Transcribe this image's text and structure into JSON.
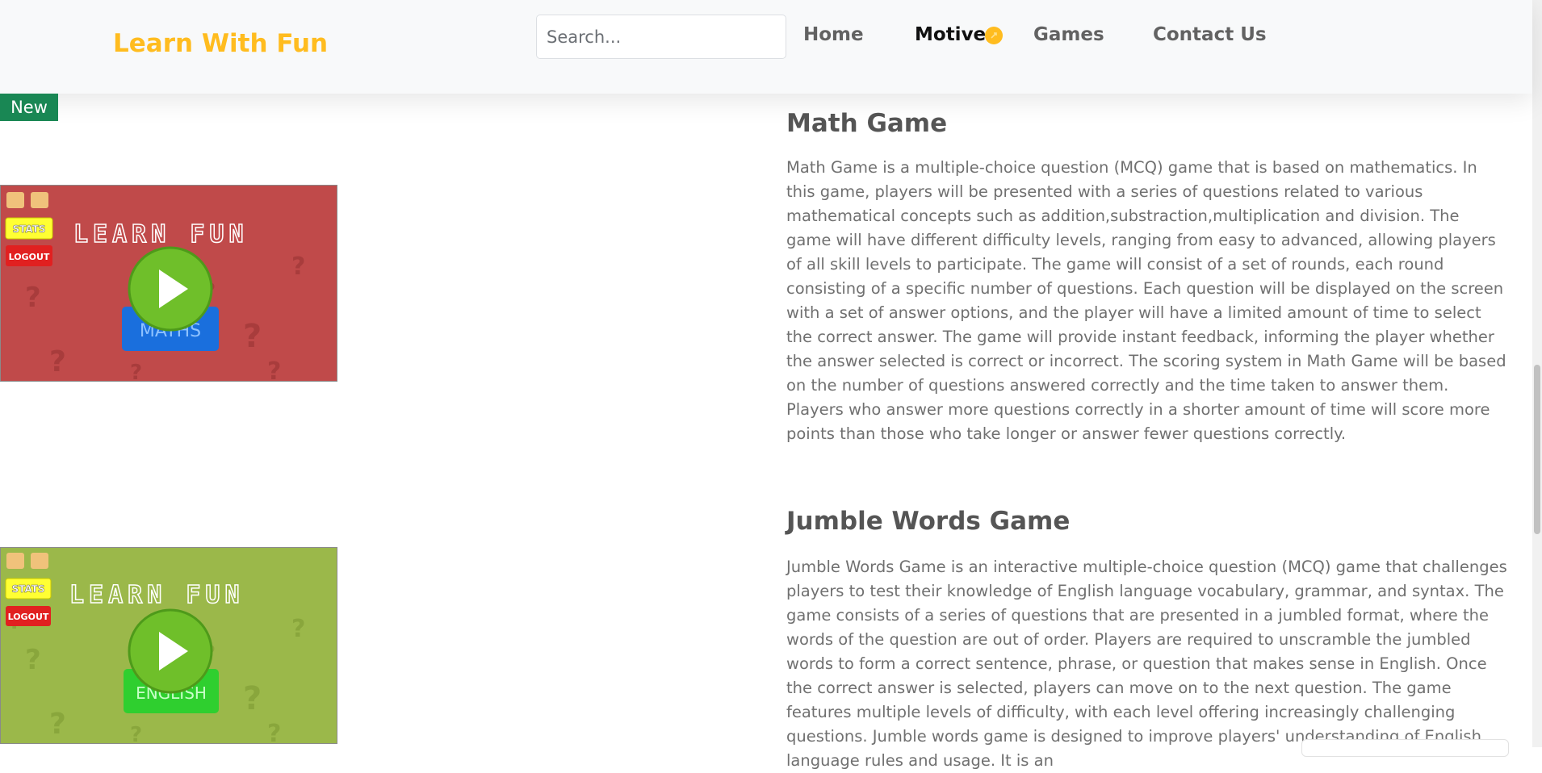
{
  "header": {
    "brand": "Learn With Fun",
    "search_placeholder": "Search...",
    "nav": {
      "home": "Home",
      "motive": "Motive",
      "games": "Games",
      "contact": "Contact Us"
    }
  },
  "badge": "New",
  "games": [
    {
      "title": "Math Game",
      "description": "Math Game is a multiple-choice question (MCQ) game that is based on mathematics. In this game, players will be presented with a series of questions related to various mathematical concepts such as addition,substraction,multiplication and division. The game will have different difficulty levels, ranging from easy to advanced, allowing players of all skill levels to participate. The game will consist of a set of rounds, each round consisting of a specific number of questions. Each question will be displayed on the screen with a set of answer options, and the player will have a limited amount of time to select the correct answer. The game will provide instant feedback, informing the player whether the answer selected is correct or incorrect. The scoring system in Math Game will be based on the number of questions answered correctly and the time taken to answer them. Players who answer more questions correctly in a shorter amount of time will score more points than those who take longer or answer fewer questions correctly.",
      "thumb": {
        "bg": "#c04a4a",
        "stats": "STATS",
        "logout": "LOGOUT",
        "banner": "LEARN FUN",
        "subject": "MATHS",
        "subject_color": "#1a6fdd"
      }
    },
    {
      "title": "Jumble Words Game",
      "description": "Jumble Words Game is an interactive multiple-choice question (MCQ) game that challenges players to test their knowledge of English language vocabulary, grammar, and syntax. The game consists of a series of questions that are presented in a jumbled format, where the words of the question are out of order. Players are required to unscramble the jumbled words to form a correct sentence, phrase, or question that makes sense in English. Once the correct answer is selected, players can move on to the next question. The game features multiple levels of difficulty, with each level offering increasingly challenging questions. Jumble words game is designed to improve players' understanding of English language rules and usage. It is an",
      "thumb": {
        "bg": "#9bb84a",
        "stats": "STATS",
        "logout": "LOGOUT",
        "banner": "LEARN FUN",
        "subject": "ENGLISH",
        "subject_color": "#2fcf2f"
      }
    }
  ],
  "colors": {
    "brand": "#ffbc1f",
    "badge": "#198754",
    "play": "#6fbf2a"
  },
  "icons": [
    "sun-icon",
    "play-icon",
    "speaker-icon",
    "music-icon"
  ]
}
